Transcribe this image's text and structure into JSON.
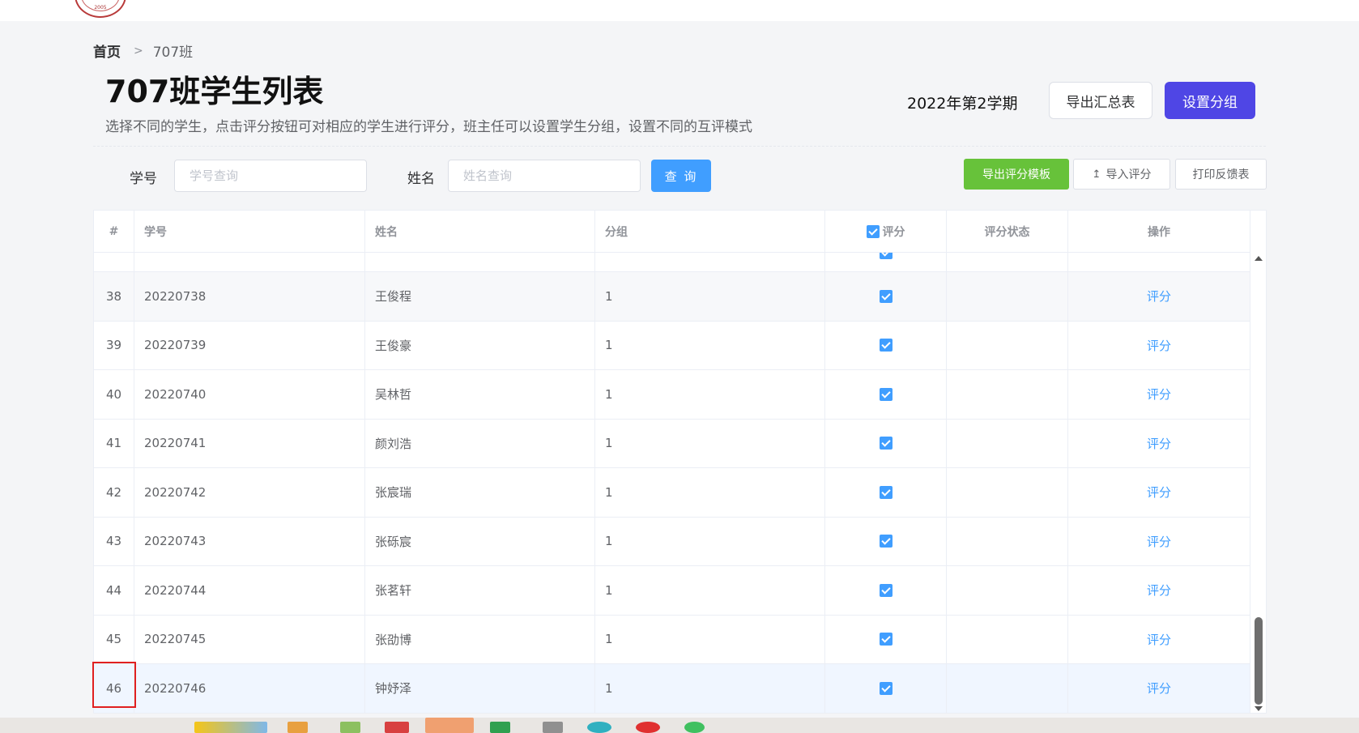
{
  "header": {
    "logo_year": "2005"
  },
  "breadcrumb": {
    "home": "首页",
    "separator": ">",
    "current": "707班"
  },
  "page": {
    "title": "707班学生列表",
    "description": "选择不同的学生，点击评分按钮可对相应的学生进行评分，班主任可以设置学生分组，设置不同的互评模式"
  },
  "toolbar": {
    "semester": "2022年第2学期",
    "export_summary_label": "导出汇总表",
    "set_group_label": "设置分组",
    "accent_color": "#4f46e5"
  },
  "search": {
    "student_id_label": "学号",
    "student_id_placeholder": "学号查询",
    "name_label": "姓名",
    "name_placeholder": "姓名查询",
    "query_label": "查 询"
  },
  "actions": {
    "export_template_label": "导出评分模板",
    "import_label": "导入评分",
    "print_label": "打印反馈表"
  },
  "table": {
    "columns": [
      "#",
      "学号",
      "姓名",
      "分组",
      "评分",
      "评分状态",
      "操作"
    ],
    "action_label": "评分",
    "rows": [
      {
        "index": "38",
        "student_id": "20220738",
        "name": "王俊程",
        "group": "1"
      },
      {
        "index": "39",
        "student_id": "20220739",
        "name": "王俊豪",
        "group": "1"
      },
      {
        "index": "40",
        "student_id": "20220740",
        "name": "吴林哲",
        "group": "1"
      },
      {
        "index": "41",
        "student_id": "20220741",
        "name": "颜刘浩",
        "group": "1"
      },
      {
        "index": "42",
        "student_id": "20220742",
        "name": "张宸瑞",
        "group": "1"
      },
      {
        "index": "43",
        "student_id": "20220743",
        "name": "张砾宸",
        "group": "1"
      },
      {
        "index": "44",
        "student_id": "20220744",
        "name": "张茗轩",
        "group": "1"
      },
      {
        "index": "45",
        "student_id": "20220745",
        "name": "张劭博",
        "group": "1"
      },
      {
        "index": "46",
        "student_id": "20220746",
        "name": "钟妤泽",
        "group": "1"
      }
    ]
  }
}
